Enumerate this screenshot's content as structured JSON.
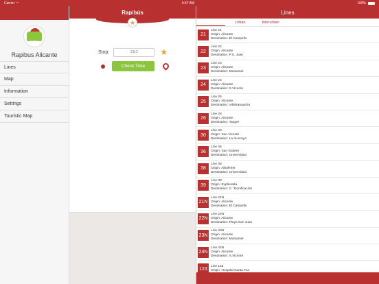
{
  "status": {
    "carrier": "Carrier",
    "time": "9:37 AM",
    "battery": "100%"
  },
  "menu": {
    "app_name": "Rapibus Alicante",
    "logo_text": "RAPIBUS",
    "items": [
      {
        "label": "Lines"
      },
      {
        "label": "Map"
      },
      {
        "label": "Information"
      },
      {
        "label": "Settings"
      },
      {
        "label": "Touristic Map"
      }
    ]
  },
  "center": {
    "title": "Rapibús",
    "stop_label": "Stop:",
    "stop_placeholder": "2112",
    "check_button_label": "Check Time"
  },
  "lines_panel": {
    "title": "Lines",
    "tabs": [
      {
        "label": "Urban"
      },
      {
        "label": "Interurban"
      }
    ],
    "lines": [
      {
        "number": "21",
        "name": "Line 21",
        "origin": "Origin: Alicante",
        "destination": "Destination: El Campello"
      },
      {
        "number": "22",
        "name": "Line 22",
        "origin": "Origin: Alicante",
        "destination": "Destination: P.S. Juan"
      },
      {
        "number": "23",
        "name": "Line 23",
        "origin": "Origin: Alicante",
        "destination": "Destination: Mutxamel"
      },
      {
        "number": "24",
        "name": "Line 24",
        "origin": "Origin: Alicante",
        "destination": "Destination: S.Vicente"
      },
      {
        "number": "25",
        "name": "Line 25",
        "origin": "Origin: Alicante",
        "destination": "Destination: Villafranqueza"
      },
      {
        "number": "26",
        "name": "Line 26",
        "origin": "Origin: Alicante",
        "destination": "Destination: Tangel"
      },
      {
        "number": "30",
        "name": "Line 30",
        "origin": "Origin: San Vicente",
        "destination": "Destination: La Alcoraya"
      },
      {
        "number": "36",
        "name": "Line 36",
        "origin": "Origin: San Gabriel",
        "destination": "Destination: Universidad"
      },
      {
        "number": "38",
        "name": "Line 38",
        "origin": "Origin: Albufeiret",
        "destination": "Destination: Universidad"
      },
      {
        "number": "39",
        "name": "Line 39",
        "origin": "Origin: Explanada",
        "destination": "Destination: C. Tecnificación"
      },
      {
        "number": "21N",
        "name": "Line 21N",
        "origin": "Origin: Alicante",
        "destination": "Destination: El Campello"
      },
      {
        "number": "22N",
        "name": "Line 22N",
        "origin": "Origin: Alicante",
        "destination": "Destination: Playa San Juan"
      },
      {
        "number": "23N",
        "name": "Line 23N",
        "origin": "Origin: Alicante",
        "destination": "Destination: Mutxamel"
      },
      {
        "number": "24N",
        "name": "Line 24N",
        "origin": "Origin: Alicante",
        "destination": "Destination: S.Vicente"
      },
      {
        "number": "123",
        "name": "Line 123",
        "origin": "Origin: Hospital Santa Faz",
        "destination": ""
      }
    ]
  },
  "colors": {
    "brand": "#b8302f",
    "accent": "#8cc63e",
    "star": "#e8a32a"
  }
}
